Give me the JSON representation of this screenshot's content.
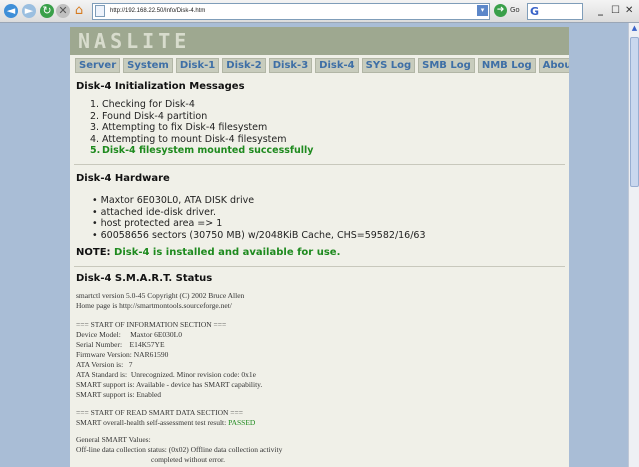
{
  "browser": {
    "url": "http://192.168.22.50/Info/Disk-4.htm",
    "go_label": "Go",
    "search_glyph": "G",
    "dropdown_glyph": "▾",
    "window_buttons": {
      "minimize": "_",
      "maximize": "☐",
      "close": "✕"
    }
  },
  "page": {
    "logo": "NASLITE",
    "nav": [
      "Server",
      "System",
      "Disk-1",
      "Disk-2",
      "Disk-3",
      "Disk-4",
      "SYS Log",
      "SMB Log",
      "NMB Log",
      "About"
    ],
    "init": {
      "title": "Disk-4 Initialization Messages",
      "items": [
        "Checking for Disk-4",
        "Found Disk-4 partition",
        "Attempting to fix Disk-4 filesystem",
        "Attempting to mount Disk-4 filesystem",
        "Disk-4 filesystem mounted successfully"
      ]
    },
    "hardware": {
      "title": "Disk-4 Hardware",
      "items": [
        "Maxtor 6E030L0, ATA DISK drive",
        "attached ide-disk driver.",
        "host protected area => 1",
        "60058656 sectors (30750 MB) w/2048KiB Cache, CHS=59582/16/63"
      ]
    },
    "note": {
      "label": "NOTE:",
      "text": "Disk-4 is installed and available for use."
    },
    "smart": {
      "title": "Disk-4 S.M.A.R.T. Status",
      "header_lines": [
        "smartctl version 5.0-45 Copyright (C) 2002 Bruce Allen",
        "Home page is http://smartmontools.sourceforge.net/"
      ],
      "info_lines": [
        "=== START OF INFORMATION SECTION ===",
        "Device Model:     Maxtor 6E030L0",
        "Serial Number:    E14K57YE",
        "Firmware Version: NAR61590",
        "ATA Version is:   7",
        "ATA Standard is:  Unrecognized. Minor revision code: 0x1e",
        "SMART support is: Available - device has SMART capability.",
        "SMART support is: Enabled"
      ],
      "read_header": "=== START OF READ SMART DATA SECTION ===",
      "health_label": "SMART overall-health self-assessment test result: ",
      "health_result": "PASSED",
      "values_lines": [
        "General SMART Values:",
        "Off-line data collection status: (0x02) Offline data collection activity",
        "                                        completed without error."
      ]
    }
  }
}
